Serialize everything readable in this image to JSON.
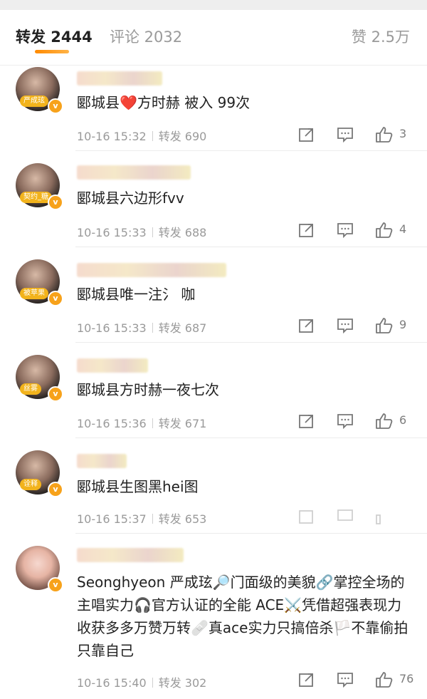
{
  "tabs": {
    "reposts_label": "转发 2444",
    "comments_label": "评论 2032",
    "likes_label": "赞 2.5万"
  },
  "reposts": [
    {
      "badge": "严成玹",
      "text_before": "郾城县",
      "emoji": "❤️",
      "text_after": "方时赫 被入 99次",
      "time": "10-16 15:32",
      "repost_label": "转发 690",
      "likes": "3"
    },
    {
      "badge": "契约_糖",
      "text": "郾城县六边形fvv",
      "time": "10-16 15:33",
      "repost_label": "转发 688",
      "likes": "4"
    },
    {
      "badge": "被苹果",
      "text": "郾城县唯一注氵 咖",
      "time": "10-16 15:33",
      "repost_label": "转发 687",
      "likes": "9"
    },
    {
      "badge": "丝雾",
      "text": "郾城县方时赫一夜七次",
      "time": "10-16 15:36",
      "repost_label": "转发 671",
      "likes": "6"
    },
    {
      "badge": "诠释",
      "text": "郾城县生图黑hei图",
      "time": "10-16 15:37",
      "repost_label": "转发 653",
      "likes": ""
    },
    {
      "badge": "",
      "text": "Seonghyeon 严成玹🔎门面级的美貌🔗掌控全场的主唱实力🎧官方认证的全能 ACE⚔️凭借超强表现力收获多多万赞万转🩹真ace实力只搞倍杀🏳️不靠偷拍只靠自己",
      "time": "10-16 15:40",
      "repost_label": "转发 302",
      "likes": "76"
    }
  ],
  "icons": {
    "share": "share-icon",
    "comment": "comment-icon",
    "like": "thumbs-up-icon",
    "verified": "verified-v-icon"
  },
  "colors": {
    "accent": "#ff8a00",
    "badge": "#f2b31c",
    "heart": "#e2231a"
  }
}
